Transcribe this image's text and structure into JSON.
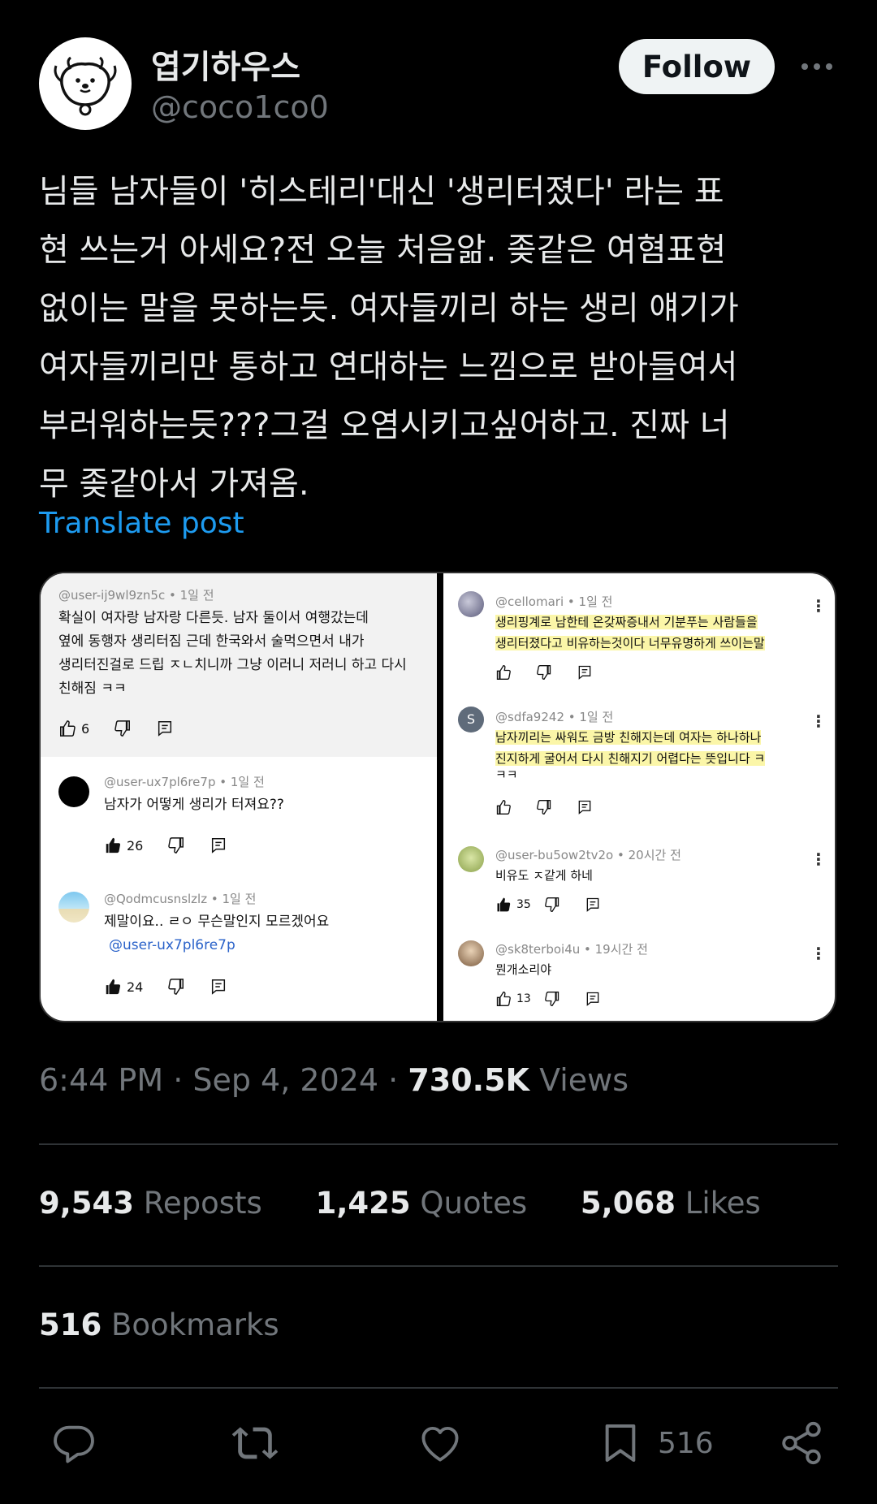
{
  "author": {
    "name": "엽기하우스",
    "handle": "@coco1co0"
  },
  "follow_label": "Follow",
  "post_lines": [
    "님들 남자들이 '히스테리'대신 '생리터졌다' 라는 표",
    "현 쓰는거 아세요?전 오늘 처음앎. 좆같은 여혐표현",
    "없이는 말을 못하는듯. 여자들끼리 하는 생리 얘기가",
    "여자들끼리만 통하고 연대하는 느낌으로 받아들여서",
    "부러워하는듯???그걸 오염시키고싶어하고. 진짜 너",
    "무 좆같아서 가져옴."
  ],
  "translate_label": "Translate post",
  "media": {
    "left": [
      {
        "user": "@user-ij9wl9zn5c",
        "time": "1일 전",
        "lines": [
          "확실이 여자랑 남자랑 다른듯. 남자 둘이서 여행갔는데",
          "옆에 동행자 생리터짐 근데 한국와서 술먹으면서 내가",
          "생리터진걸로 드립 ㅈㄴ치니까 그냥 이러니 저러니 하고 다시",
          "친해짐 ㅋㅋ"
        ],
        "likes": "6"
      },
      {
        "user": "@user-ux7pl6re7p",
        "time": "1일 전",
        "lines": [
          "남자가 어떻게 생리가 터져요??"
        ],
        "likes": "26"
      },
      {
        "user": "@Qodmcusnslzlz",
        "time": "1일 전",
        "lines": [
          "제말이요.. ㄹㅇ 무슨말인지 모르겠어요"
        ],
        "mention": "@user-ux7pl6re7p",
        "likes": "24"
      }
    ],
    "right": [
      {
        "user": "@cellomari",
        "time": "1일 전",
        "lines": [
          "생리핑계로 남한테 온갖짜증내서 기분푸는 사람들을",
          "생리터졌다고 비유하는것이다 너무유명하게 쓰이는말"
        ]
      },
      {
        "user": "@sdfa9242",
        "time": "1일 전",
        "avatar_letter": "S",
        "lines": [
          "남자끼리는 싸워도 금방 친해지는데 여자는 하나하나",
          "진지하게 굴어서 다시 친해지기 어렵다는 뜻입니다 ㅋ",
          "ㅋㅋ"
        ]
      },
      {
        "user": "@user-bu5ow2tv2o",
        "time": "20시간 전",
        "lines": [
          "비유도 ㅈ같게 하네"
        ],
        "likes": "35"
      },
      {
        "user": "@sk8terboi4u",
        "time": "19시간 전",
        "lines": [
          "뭔개소리야"
        ],
        "likes": "13"
      }
    ]
  },
  "timestamp": {
    "time": "6:44 PM · Sep 4, 2024 · ",
    "views_count": "730.5K",
    "views_label": " Views"
  },
  "stats": {
    "reposts_count": "9,543",
    "reposts_label": " Reposts",
    "quotes_count": "1,425",
    "quotes_label": " Quotes",
    "likes_count": "5,068",
    "likes_label": " Likes",
    "bookmarks_count": "516",
    "bookmarks_label": " Bookmarks"
  },
  "action_bar": {
    "bookmark_count": "516",
    "icons": [
      "reply-icon",
      "repost-icon",
      "like-icon",
      "bookmark-icon",
      "share-icon"
    ]
  },
  "colors": {
    "background": "#000000",
    "text": "#e7e9ea",
    "muted": "#71767b",
    "link": "#1d9bf0",
    "highlight": "#fbf6a8"
  }
}
